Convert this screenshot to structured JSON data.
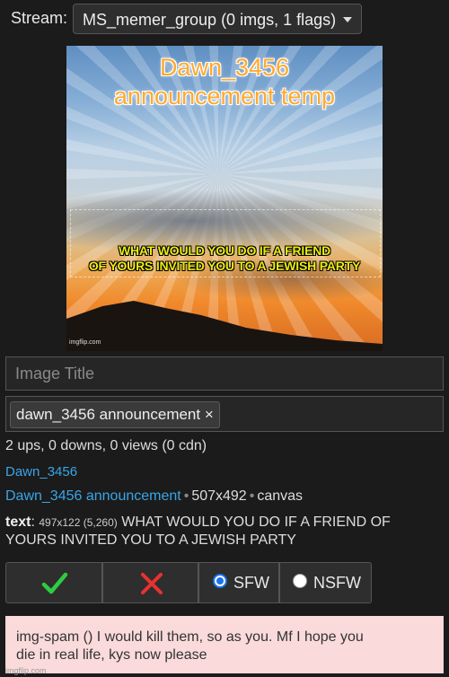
{
  "stream": {
    "label": "Stream:",
    "selected": "MS_memer_group (0 imgs, 1 flags)"
  },
  "meme": {
    "title_line1": "Dawn_3456",
    "title_line2": "announcement temp",
    "caption_line1": "WHAT WOULD YOU DO IF A FRIEND",
    "caption_line2": "OF YOURS INVITED YOU TO A JEWISH PARTY",
    "watermark": "imgflip.com"
  },
  "title_input": {
    "placeholder": "Image Title"
  },
  "tags": [
    {
      "label": "dawn_3456 announcement",
      "remove": "×"
    }
  ],
  "stats": "2 ups, 0 downs, 0 views (0 cdn)",
  "author": "Dawn_3456",
  "template": {
    "name": "Dawn_3456 announcement",
    "dimensions": "507x492",
    "type": "canvas",
    "separator": "•"
  },
  "text_info": {
    "label": "text",
    "colon": ":",
    "size": "497x122 (5,260)",
    "content_line1": "WHAT WOULD YOU DO IF A FRIEND OF",
    "content_line2": "YOURS INVITED YOU TO A JEWISH PARTY"
  },
  "actions": {
    "approve_icon": "✔",
    "reject_icon": "✖",
    "sfw_label": "SFW",
    "nsfw_label": "NSFW",
    "sfw_selected": true
  },
  "colors": {
    "approve": "#2ecc40",
    "reject": "#e8322f",
    "link": "#39a5e8",
    "flag_bg": "#fadada"
  },
  "flag": {
    "line1": "img-spam () I would kill them, so as you. Mf I hope you",
    "line2": "die in real life, kys now please"
  },
  "footer_watermark": "imgflip.com"
}
